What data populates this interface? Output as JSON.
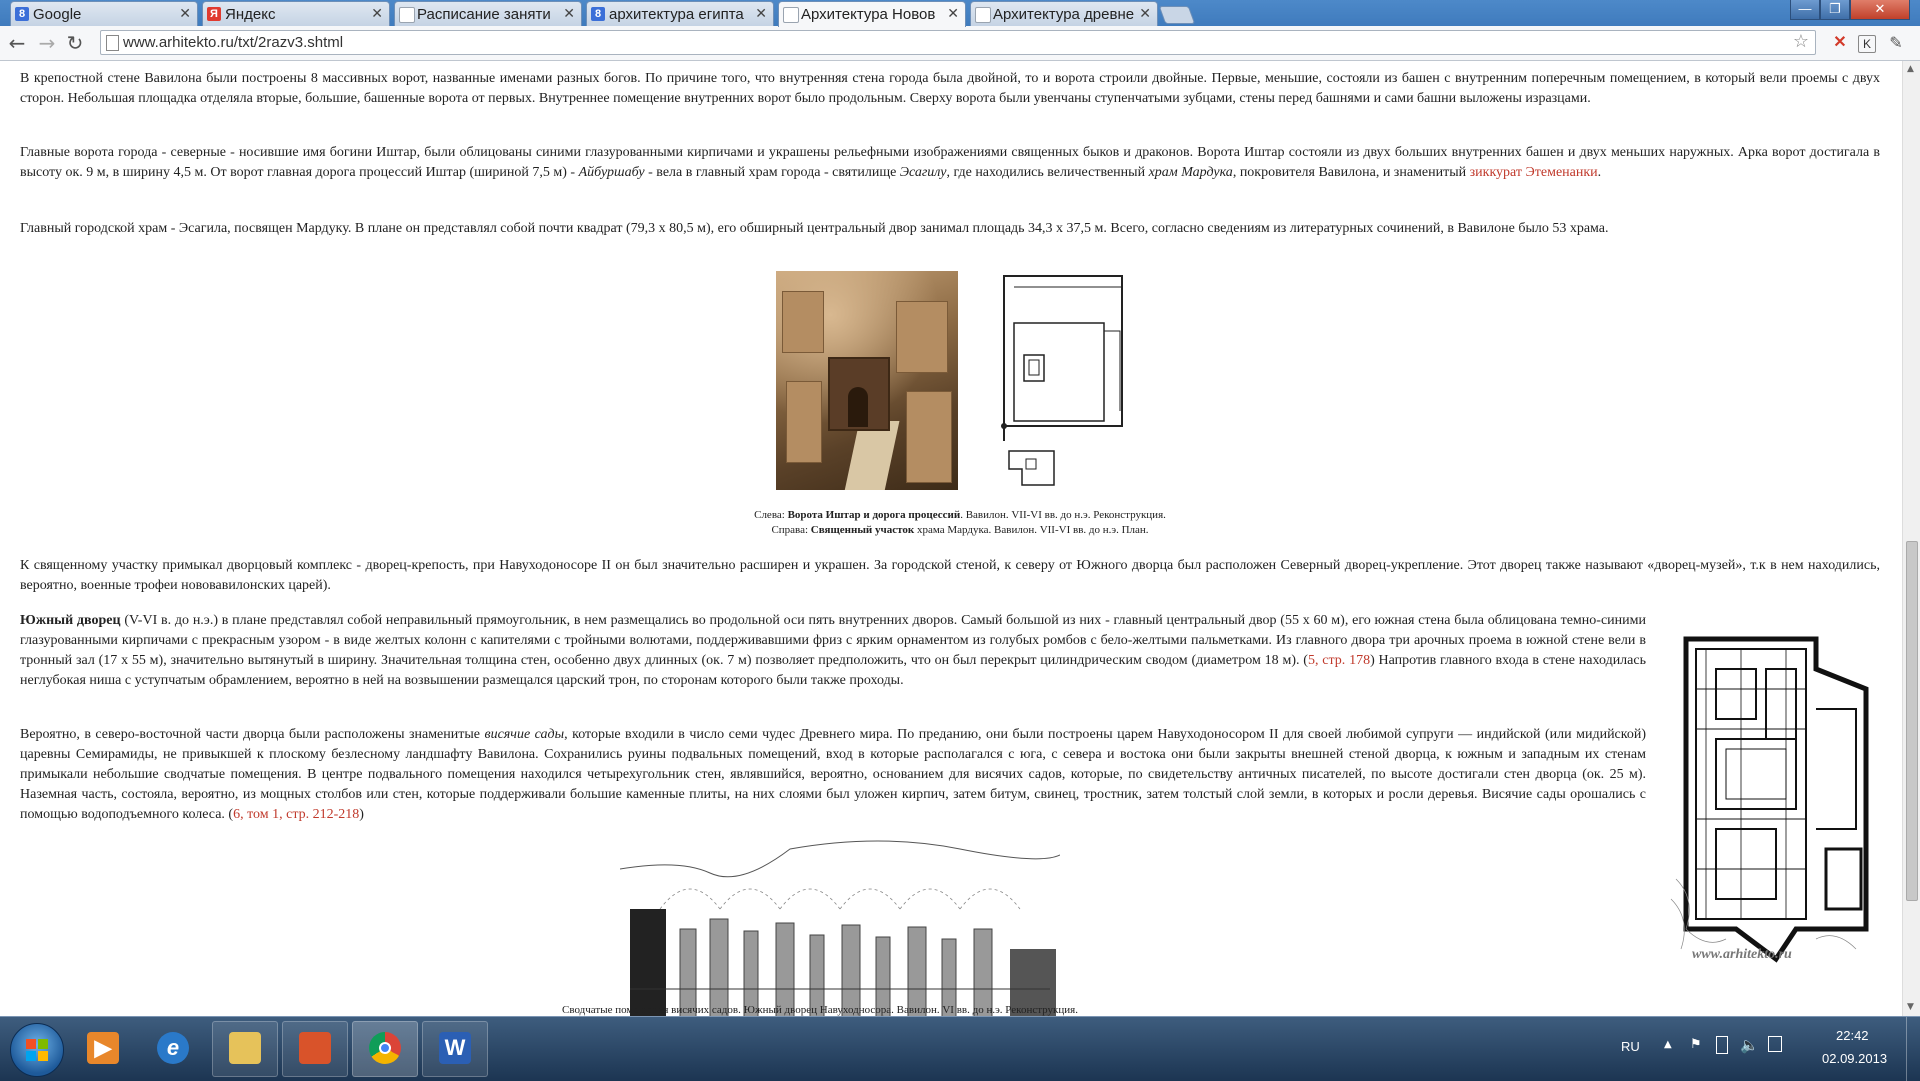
{
  "tabs": [
    {
      "label": "Google",
      "icon": "google-favicon",
      "color": "#3b6fd8",
      "glyph": "8"
    },
    {
      "label": "Яндекс",
      "icon": "yandex-favicon",
      "color": "#e03a2f",
      "glyph": "Я"
    },
    {
      "label": "Расписание заняти",
      "icon": "page-favicon",
      "color": "#9aa4b0",
      "glyph": ""
    },
    {
      "label": "архитектура египта",
      "icon": "google-favicon",
      "color": "#3b6fd8",
      "glyph": "8"
    },
    {
      "label": "Архитектура Новов",
      "icon": "page-favicon",
      "color": "#9aa4b0",
      "glyph": "",
      "active": true
    },
    {
      "label": "Архитектура древне",
      "icon": "page-favicon",
      "color": "#9aa4b0",
      "glyph": ""
    }
  ],
  "toolbar": {
    "url": "www.arhitekto.ru/txt/2razv3.shtml",
    "back": "←",
    "forward": "→",
    "reload": "↻",
    "star": "☆"
  },
  "window_controls": {
    "minimize": "—",
    "maximize": "❐",
    "close": "✕"
  },
  "article": {
    "p1": "В крепостной стене Вавилона были построены 8 массивных ворот, названные именами разных богов. По причине того, что внутренняя стена города была двойной, то и ворота строили двойные. Первые, меньшие, состояли из башен с внутренним поперечным помещением, в который вели проемы с двух сторон. Небольшая площадка отделяла вторые, большие, башенные ворота от первых. Внутреннее помещение внутренних ворот было продольным. Сверху ворота были увенчаны ступенчатыми зубцами, стены перед башнями и сами башни выложены изразцами.",
    "p2_a": "Главные ворота города - северные - носившие имя богини Иштар, были облицованы синими глазурованными кирпичами и украшены рельефными изображениями священных быков и драконов. Ворота Иштар состояли из двух больших внутренних башен и двух меньших наружных. Арка ворот достигала в высоту ок. 9 м, в ширину 4,5 м. От ворот главная дорога процессий Иштар (шириной 7,5 м) - ",
    "p2_b": "Айбуршабу",
    "p2_c": " - вела в главный храм города - святилище ",
    "p2_d": "Эсагилу",
    "p2_e": ", где находились величественный ",
    "p2_f": "храм Мардука",
    "p2_g": ", покровителя Вавилона, и знаменитый ",
    "p2_link": "зиккурат Этеменанки",
    "p2_h": ".",
    "p3": "Главный городской храм - Эсагила, посвящен Мардуку. В плане он представлял собой почти квадрат (79,3 х 80,5 м), его обширный центральный двор занимал площадь 34,3 х 37,5 м. Всего, согласно сведениям из литературных сочинений, в Вавилоне было 53 храма.",
    "cap1_a": "Слева: ",
    "cap1_b": "Ворота Иштар и дорога процессий",
    "cap1_c": ". Вавилон. VII-VI вв. до н.э. Реконструкция.",
    "cap2_a": "Справа: ",
    "cap2_b": "Священный участок",
    "cap2_c": " храма Мардука. Вавилон. VII-VI вв. до н.э. План.",
    "p4": "К священному участку примыкал дворцовый комплекс - дворец-крепость, при Навуходоносоре II он был значительно расширен и украшен. За городской стеной, к северу от Южного дворца был расположен Северный дворец-укрепление. Этот дворец также называют «дворец-музей», т.к в нем находились, вероятно, военные трофеи нововавилонских царей).",
    "p5_a": "Южный дворец",
    "p5_b": " (V-VI в. до н.э.) в плане представлял собой неправильный прямоугольник, в нем размещались во продольной оси пять внутренних дворов. Самый большой из них - главный центральный двор (55 х 60 м), его южная стена была облицована темно-синими глазурованными кирпичами с прекрасным узором - в виде желтых колонн с капителями с тройными волютами, поддерживавшими фриз с ярким орнаментом из голубых ромбов с бело-желтыми пальметками. Из главного двора три арочных проема в южной стене вели в тронный зал (17 х 55 м), значительно вытянутый в ширину. Значительная толщина стен, особенно двух длинных (ок. 7 м) позволяет предположить, что он был перекрыт цилиндрическим сводом (диаметром 18 м). (",
    "p5_link": "5, стр. 178",
    "p5_c": ") Напротив главного входа в стене находилась неглубокая ниша с уступчатым обрамлением, вероятно в ней на возвышении размещался царский трон, по сторонам которого были также проходы.",
    "p6_a": "Вероятно, в северо-восточной части дворца были расположены знаменитые ",
    "p6_b": "висячие сады",
    "p6_c": ", которые входили в число семи чудес Древнего мира. По преданию, они были построены царем Навуходоносором II для своей любимой супруги — индийской (или мидийской) царевны Семирамиды, не привыкшей к плоскому безлесному ландшафту Вавилона. Сохранились руины подвальных помещений, вход в которые располагался с юга, с севера и востока они были закрыты внешней стеной дворца, к южным и западным их стенам примыкали небольшие сводчатые помещения. В центре подвального помещения находился четырехугольник стен, являвшийся, вероятно, основанием для висячих садов, которые, по свидетельству античных писателей, по высоте достигали стен дворца (ок. 25 м). Наземная часть, состояла, вероятно, из мощных столбов или стен, которые поддерживали большие каменные плиты, на них слоями был уложен кирпич, затем битум, свинец, тростник, затем толстый слой земли, в которых и росли деревья. Висячие сады орошались с помощью водоподъемного колеса. (",
    "p6_link": "6, том 1, стр. 212-218",
    "p6_d": ")",
    "watermark": "www.arhitekto.ru",
    "cap3": "Сводчатые помещения висячих садов. Южный дворец Навуходносора. Вавилон. VI вв. до н.э. Реконструкция."
  },
  "taskbar": {
    "apps": [
      {
        "name": "media-player-icon",
        "glyph": "▶",
        "color": "#e8872b"
      },
      {
        "name": "internet-explorer-icon",
        "glyph": "e",
        "color": "#2a79c9"
      },
      {
        "name": "file-explorer-icon",
        "glyph": "",
        "color": "#e6c25a"
      },
      {
        "name": "paint-icon",
        "glyph": "",
        "color": "#d9532a"
      },
      {
        "name": "chrome-icon",
        "glyph": "",
        "color": "#3a9a3a"
      },
      {
        "name": "word-icon",
        "glyph": "W",
        "color": "#2b5fb4"
      }
    ],
    "lang": "RU",
    "time": "22:42",
    "date": "02.09.2013"
  }
}
